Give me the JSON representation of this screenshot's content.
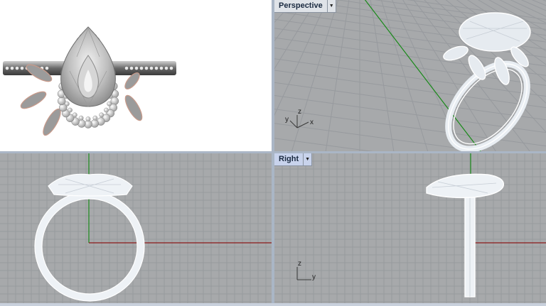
{
  "viewports": {
    "top_left": {
      "name": "",
      "kind": "rendered"
    },
    "perspective": {
      "name": "Perspective",
      "axes": {
        "x": "x",
        "y": "y",
        "z": "z"
      }
    },
    "front": {
      "name": "",
      "axes": {}
    },
    "right": {
      "name": "Right",
      "axes": {
        "y": "y",
        "z": "z"
      }
    }
  },
  "icons": {
    "dropdown": "chevron-down-icon"
  },
  "colors": {
    "grid_bg": "#a7a9ab",
    "grid_line": "#979a9e",
    "x_axis": "#8b1a1a",
    "y_axis": "#1a8a1a",
    "label_bg": "#dfe3e8",
    "active_label_bg": "#c8d3ec",
    "wire": "#ffffff",
    "metal": "#8f8f8f",
    "rose": "#c89a8a"
  }
}
